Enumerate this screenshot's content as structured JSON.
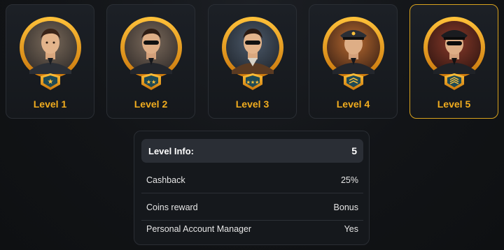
{
  "levels": [
    {
      "label": "Level 1",
      "icon": "star-badge-icon"
    },
    {
      "label": "Level 2",
      "icon": "two-star-badge-icon"
    },
    {
      "label": "Level 3",
      "icon": "three-star-badge-icon"
    },
    {
      "label": "Level 4",
      "icon": "chevron-badge-icon"
    },
    {
      "label": "Level 5",
      "icon": "rank-badge-icon"
    }
  ],
  "selected_level": 5,
  "colors": {
    "accent": "#f2ad1f",
    "selected_border": "#d8a21e",
    "ring": "#e89a16"
  },
  "info": {
    "title": "Level Info:",
    "value": "5",
    "rows": [
      {
        "label": "Cashback",
        "value": "25%"
      },
      {
        "label": "Coins reward",
        "value": "Bonus"
      },
      {
        "label": "Personal Account Manager",
        "value": "Yes"
      }
    ]
  }
}
